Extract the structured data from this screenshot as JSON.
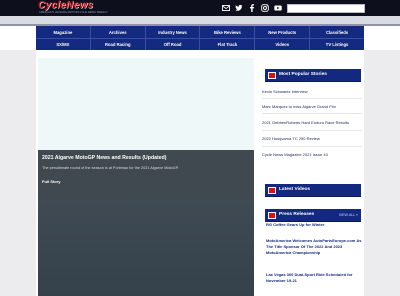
{
  "header": {
    "logo_text": "CycleNews",
    "logo_tagline": "AMERICA'S LEADING MOTORCYCLE NEWS WEEKLY",
    "social_icons": [
      "email-icon",
      "twitter-icon",
      "facebook-icon",
      "instagram-icon",
      "youtube-icon"
    ],
    "search_placeholder": ""
  },
  "nav": {
    "row1": [
      "Magazine",
      "Archives",
      "Industry News",
      "Bike Reviews",
      "New Products",
      "Classifieds"
    ],
    "row2": [
      "SX/MX",
      "Road Racing",
      "Off Road",
      "Flat Track",
      "Videos",
      "TV Listings"
    ]
  },
  "hero": {
    "title": "2021 Algarve MotoGP News and Results (Updated)",
    "description": "The penultimate round of the season is at Portimao for the 2021 Algarve MotoGP.",
    "link": "Full Story"
  },
  "sidebar": {
    "popular_title": "Most Popular Stories",
    "popular_items": [
      "Kevin Schwantz Interview",
      "Marc Marquez to miss Algarve Grand Prix",
      "2021 GebbenRoberts Hard Enduro Race Results",
      "2022 Husqvarna TC 250 Review",
      "Cycle News Magazine 2021 Issue 43"
    ],
    "videos_title": "Latest Videos",
    "press_title": "Press Releases",
    "press_view_all": "VIEW ALL »",
    "press_items": [
      "RG Coffee Gears Up for Winter",
      "MotoAmerica Welcomes AutoPartsEurope.com As The Title Sponsor Of The 2022 And 2023 MotoAmerica Championship",
      "Las Vegas 300 Dual-Sport Ride Scheduled for November 19-21"
    ]
  },
  "colors": {
    "nav_bg": "#132a80",
    "top_bar": "#0d0f1d",
    "accent_red": "#d8101c"
  }
}
